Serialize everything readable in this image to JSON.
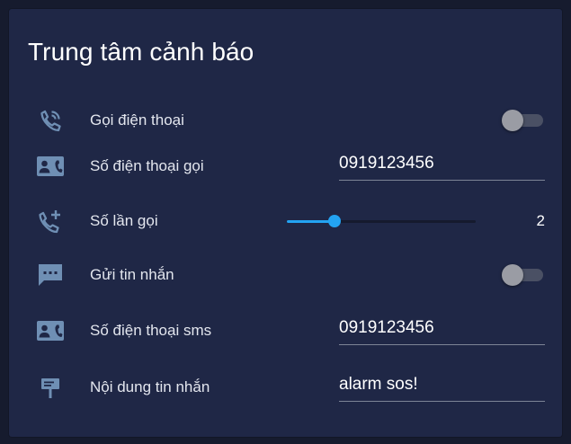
{
  "panel": {
    "title": "Trung tâm cảnh báo"
  },
  "colors": {
    "background": "#161b2e",
    "card": "#1f2746",
    "icon": "#6f8fb4",
    "accent": "#23a3f2"
  },
  "rows": {
    "call": {
      "icon": "phone-in-talk-icon",
      "label": "Gọi điện thoại",
      "toggle_on": false
    },
    "call_number": {
      "icon": "contact-phone-icon",
      "label": "Số điện thoại gọi",
      "value": "0919123456"
    },
    "call_count": {
      "icon": "phone-plus-icon",
      "label": "Số lần gọi",
      "value": "2",
      "fraction": 0.25
    },
    "sms": {
      "icon": "message-text-icon",
      "label": "Gửi tin nhắn",
      "toggle_on": false
    },
    "sms_number": {
      "icon": "contact-phone-icon",
      "label": "Số điện thoại sms",
      "value": "0919123456"
    },
    "sms_content": {
      "icon": "message-board-icon",
      "label": "Nội dung tin nhắn",
      "value": "alarm sos!"
    }
  }
}
